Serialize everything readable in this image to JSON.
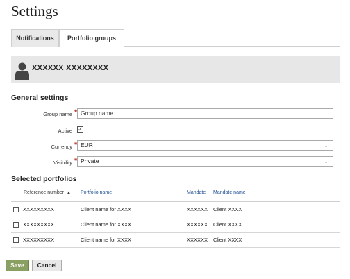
{
  "page": {
    "title": "Settings"
  },
  "tabs": [
    {
      "label": "Notifications",
      "active": false
    },
    {
      "label": "Portfolio groups",
      "active": true
    }
  ],
  "user": {
    "name": "XXXXXX XXXXXXXX",
    "icon": "user-icon"
  },
  "general_settings": {
    "title": "General settings",
    "group_name": {
      "label": "Group name",
      "required": true,
      "value": "",
      "placeholder": "Group name"
    },
    "active": {
      "label": "Active",
      "checked": true
    },
    "currency": {
      "label": "Currency",
      "required": true,
      "value": "EUR"
    },
    "visibility": {
      "label": "Visibility",
      "required": true,
      "value": "Private"
    }
  },
  "selected_portfolios": {
    "title": "Selected portfolios",
    "columns": [
      "Reference number",
      "Portfolio name",
      "Mandate",
      "Mandate name"
    ],
    "sort_column": "Reference number",
    "rows": [
      {
        "reference": "XXXXXXXXX",
        "portfolio_name": "Client name for XXXX",
        "mandate": "XXXXXX",
        "mandate_name": "Client  XXXX"
      },
      {
        "reference": "XXXXXXXXX",
        "portfolio_name": "Client name for XXXX",
        "mandate": "XXXXXX",
        "mandate_name": "Client  XXXX"
      },
      {
        "reference": "XXXXXXXXX",
        "portfolio_name": "Client name for XXXX",
        "mandate": "XXXXXX",
        "mandate_name": "Client  XXXX"
      }
    ]
  },
  "actions": {
    "save": "Save",
    "cancel": "Cancel"
  },
  "colors": {
    "save_button": "#8a9f62",
    "link": "#1d4f91",
    "required": "#c0392b",
    "banner": "#e7e7e7"
  }
}
